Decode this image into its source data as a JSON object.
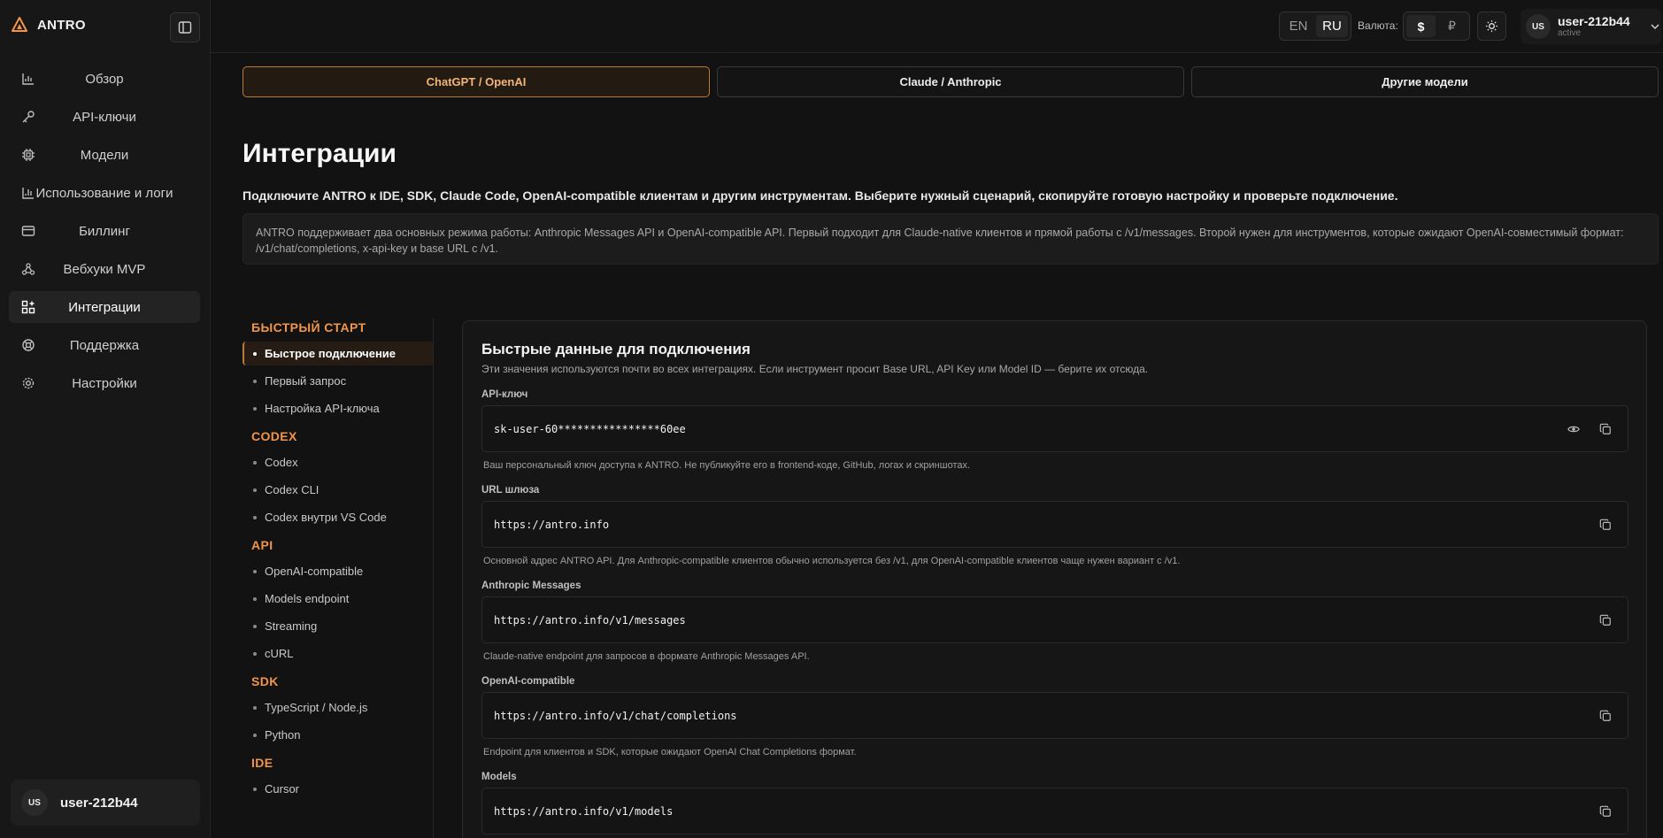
{
  "brand": {
    "name": "ANTRO"
  },
  "sidebar": {
    "items": [
      {
        "label": "Обзор",
        "icon": "chart-icon"
      },
      {
        "label": "API-ключи",
        "icon": "key-icon"
      },
      {
        "label": "Модели",
        "icon": "cpu-icon"
      },
      {
        "label": "Использование и логи",
        "icon": "bar-chart-icon"
      },
      {
        "label": "Биллинг",
        "icon": "card-icon"
      },
      {
        "label": "Вебхуки MVP",
        "icon": "webhook-icon"
      },
      {
        "label": "Интеграции",
        "icon": "grid-plus-icon",
        "active": true
      },
      {
        "label": "Поддержка",
        "icon": "lifebuoy-icon"
      },
      {
        "label": "Настройки",
        "icon": "gear-icon"
      }
    ],
    "user": {
      "initials": "US",
      "name": "user-212b44"
    }
  },
  "topbar": {
    "languages": [
      "EN",
      "RU"
    ],
    "active_language": "RU",
    "currency_label": "Валюта:",
    "currencies": [
      "$",
      "₽"
    ],
    "active_currency": "$",
    "user": {
      "initials": "US",
      "name": "user-212b44",
      "status": "active"
    }
  },
  "tabs": [
    {
      "label": "ChatGPT / OpenAI",
      "active": true
    },
    {
      "label": "Claude / Anthropic"
    },
    {
      "label": "Другие модели"
    }
  ],
  "page": {
    "title": "Интеграции",
    "lead": "Подключите ANTRO к IDE, SDK, Claude Code, OpenAI-compatible клиентам и другим инструментам. Выберите нужный сценарий, скопируйте готовую настройку и проверьте подключение.",
    "info": "ANTRO поддерживает два основных режима работы: Anthropic Messages API и OpenAI-compatible API. Первый подходит для Claude-native клиентов и прямой работы с /v1/messages. Второй нужен для инструментов, которые ожидают OpenAI-совместимый формат: /v1/chat/completions, x-api-key и base URL с /v1."
  },
  "docs_nav": [
    {
      "title": "БЫСТРЫЙ СТАРТ",
      "items": [
        "Быстрое подключение",
        "Первый запрос",
        "Настройка API-ключа"
      ],
      "active": 0
    },
    {
      "title": "CODEX",
      "items": [
        "Codex",
        "Codex CLI",
        "Codex внутри VS Code"
      ]
    },
    {
      "title": "API",
      "items": [
        "OpenAI-compatible",
        "Models endpoint",
        "Streaming",
        "cURL"
      ]
    },
    {
      "title": "SDK",
      "items": [
        "TypeScript / Node.js",
        "Python"
      ]
    },
    {
      "title": "IDE",
      "items": [
        "Cursor"
      ]
    }
  ],
  "card": {
    "title": "Быстрые данные для подключения",
    "subtitle": "Эти значения используются почти во всех интеграциях. Если инструмент просит Base URL, API Key или Model ID — берите их отсюда.",
    "fields": [
      {
        "label": "API-ключ",
        "value": "sk-user-60****************60ee",
        "help": "Ваш персональный ключ доступа к ANTRO. Не публикуйте его в frontend-коде, GitHub, логах и скриншотах.",
        "reveal": true
      },
      {
        "label": "URL шлюза",
        "value": "https://antro.info",
        "help": "Основной адрес ANTRO API. Для Anthropic-compatible клиентов обычно используется без /v1, для OpenAI-compatible клиентов чаще нужен вариант с /v1."
      },
      {
        "label": "Anthropic Messages",
        "value": "https://antro.info/v1/messages",
        "help": "Claude-native endpoint для запросов в формате Anthropic Messages API."
      },
      {
        "label": "OpenAI-compatible",
        "value": "https://antro.info/v1/chat/completions",
        "help": "Endpoint для клиентов и SDK, которые ожидают OpenAI Chat Completions формат."
      },
      {
        "label": "Models",
        "value": "https://antro.info/v1/models",
        "help": ""
      }
    ]
  },
  "colors": {
    "accent": "#f0954a",
    "accent_border": "#b87a3b",
    "bg": "#121212"
  }
}
